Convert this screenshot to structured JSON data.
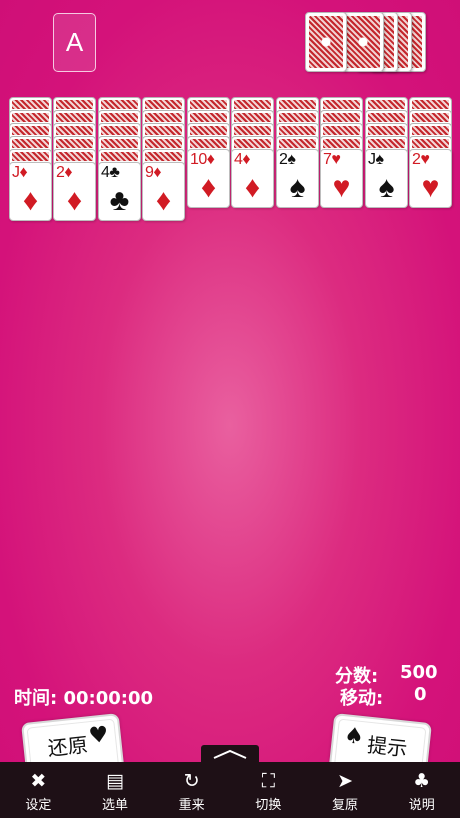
{
  "foundation": {
    "label": "A"
  },
  "columns": [
    {
      "hidden": 5,
      "card": {
        "rank": "J",
        "suit": "♦",
        "color": "red"
      }
    },
    {
      "hidden": 5,
      "card": {
        "rank": "2",
        "suit": "♦",
        "color": "red"
      }
    },
    {
      "hidden": 5,
      "card": {
        "rank": "4",
        "suit": "♣",
        "color": "black"
      }
    },
    {
      "hidden": 5,
      "card": {
        "rank": "9",
        "suit": "♦",
        "color": "red"
      }
    },
    {
      "hidden": 4,
      "card": {
        "rank": "10",
        "suit": "♦",
        "color": "red"
      }
    },
    {
      "hidden": 4,
      "card": {
        "rank": "4",
        "suit": "♦",
        "color": "red"
      }
    },
    {
      "hidden": 4,
      "card": {
        "rank": "2",
        "suit": "♠",
        "color": "black"
      }
    },
    {
      "hidden": 4,
      "card": {
        "rank": "7",
        "suit": "♥",
        "color": "red"
      }
    },
    {
      "hidden": 4,
      "card": {
        "rank": "J",
        "suit": "♠",
        "color": "black"
      }
    },
    {
      "hidden": 4,
      "card": {
        "rank": "2",
        "suit": "♥",
        "color": "red"
      }
    }
  ],
  "stock": {
    "piles": 5
  },
  "colors": {
    "red": "#d11b24",
    "black": "#111111",
    "background": "#d4127a",
    "toolbar": "#1e1016"
  },
  "status": {
    "time_label": "时间:",
    "time_value": "00:00:00",
    "score_label": "分数:",
    "score_value": "500",
    "moves_label": "移动:",
    "moves_value": "0"
  },
  "undo_card": {
    "label": "还原",
    "suit": "♥"
  },
  "hint_card": {
    "label": "提示",
    "suit": "♠"
  },
  "toolbar": [
    {
      "icon": "settings-tools-icon",
      "glyph": "✖",
      "label": "设定"
    },
    {
      "icon": "menu-document-icon",
      "glyph": "▤",
      "label": "选单"
    },
    {
      "icon": "restart-icon",
      "glyph": "↻",
      "label": "重来"
    },
    {
      "icon": "switch-expand-icon",
      "glyph": "⛶",
      "label": "切换"
    },
    {
      "icon": "redo-arrow-icon",
      "glyph": "➤",
      "label": "复原"
    },
    {
      "icon": "help-club-card-icon",
      "glyph": "♣",
      "label": "说明"
    }
  ]
}
